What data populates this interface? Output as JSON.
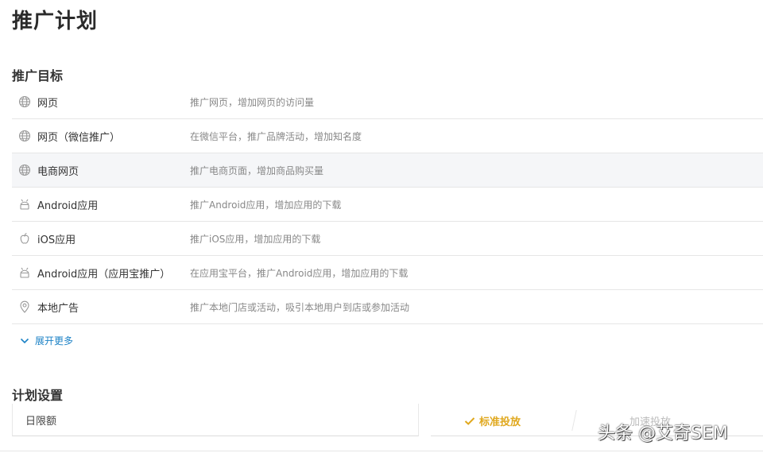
{
  "page": {
    "title": "推广计划"
  },
  "goal_section": {
    "title": "推广目标",
    "items": [
      {
        "name": "网页",
        "desc": "推广网页，增加网页的访问量",
        "icon": "globe-icon"
      },
      {
        "name": "网页（微信推广）",
        "desc": "在微信平台，推广品牌活动，增加知名度",
        "icon": "globe-icon"
      },
      {
        "name": "电商网页",
        "desc": "推广电商页面，增加商品购买量",
        "icon": "globe-icon"
      },
      {
        "name": "Android应用",
        "desc": "推广Android应用，增加应用的下载",
        "icon": "android-icon"
      },
      {
        "name": "iOS应用",
        "desc": "推广iOS应用，增加应用的下载",
        "icon": "apple-icon"
      },
      {
        "name": "Android应用（应用宝推广）",
        "desc": "在应用宝平台，推广Android应用，增加应用的下载",
        "icon": "android-icon"
      },
      {
        "name": "本地广告",
        "desc": "推广本地门店或活动，吸引本地用户到店或参加活动",
        "icon": "location-pin-icon"
      }
    ],
    "expand_label": "展开更多"
  },
  "plan_section": {
    "title": "计划设置",
    "budget_label": "日限额",
    "delivery": {
      "standard_label": "标准投放",
      "fast_label": "加速投放"
    }
  },
  "watermark": "头条 @艾奇SEM",
  "colors": {
    "accent_blue": "#1c82c6",
    "selected_gold": "#e0a81e",
    "desc_gray": "#888888"
  }
}
